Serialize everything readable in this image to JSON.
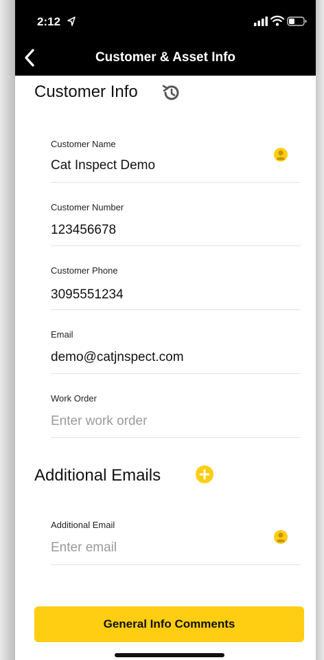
{
  "status_bar": {
    "time": "2:12"
  },
  "nav": {
    "title": "Customer & Asset Info"
  },
  "customer_info": {
    "title": "Customer Info",
    "fields": [
      {
        "label": "Customer Name",
        "value": "Cat Inspect Demo",
        "placeholder": ""
      },
      {
        "label": "Customer Number",
        "value": "123456678",
        "placeholder": ""
      },
      {
        "label": "Customer Phone",
        "value": "3095551234",
        "placeholder": ""
      },
      {
        "label": "Email",
        "value": "demo@catjnspect.com",
        "placeholder": ""
      },
      {
        "label": "Work Order",
        "value": "",
        "placeholder": "Enter work order"
      }
    ]
  },
  "additional_emails": {
    "title": "Additional Emails",
    "field": {
      "label": "Additional Email",
      "value": "",
      "placeholder": "Enter email"
    }
  },
  "footer": {
    "comments_label": "General Info Comments"
  },
  "colors": {
    "accent": "#ffcd11",
    "nav_background": "#000000",
    "placeholder": "#9a9a9a"
  },
  "icons": {
    "back": "chevron-left-icon",
    "history": "history-icon",
    "add": "plus-circle-icon",
    "contact": "person-icon"
  }
}
